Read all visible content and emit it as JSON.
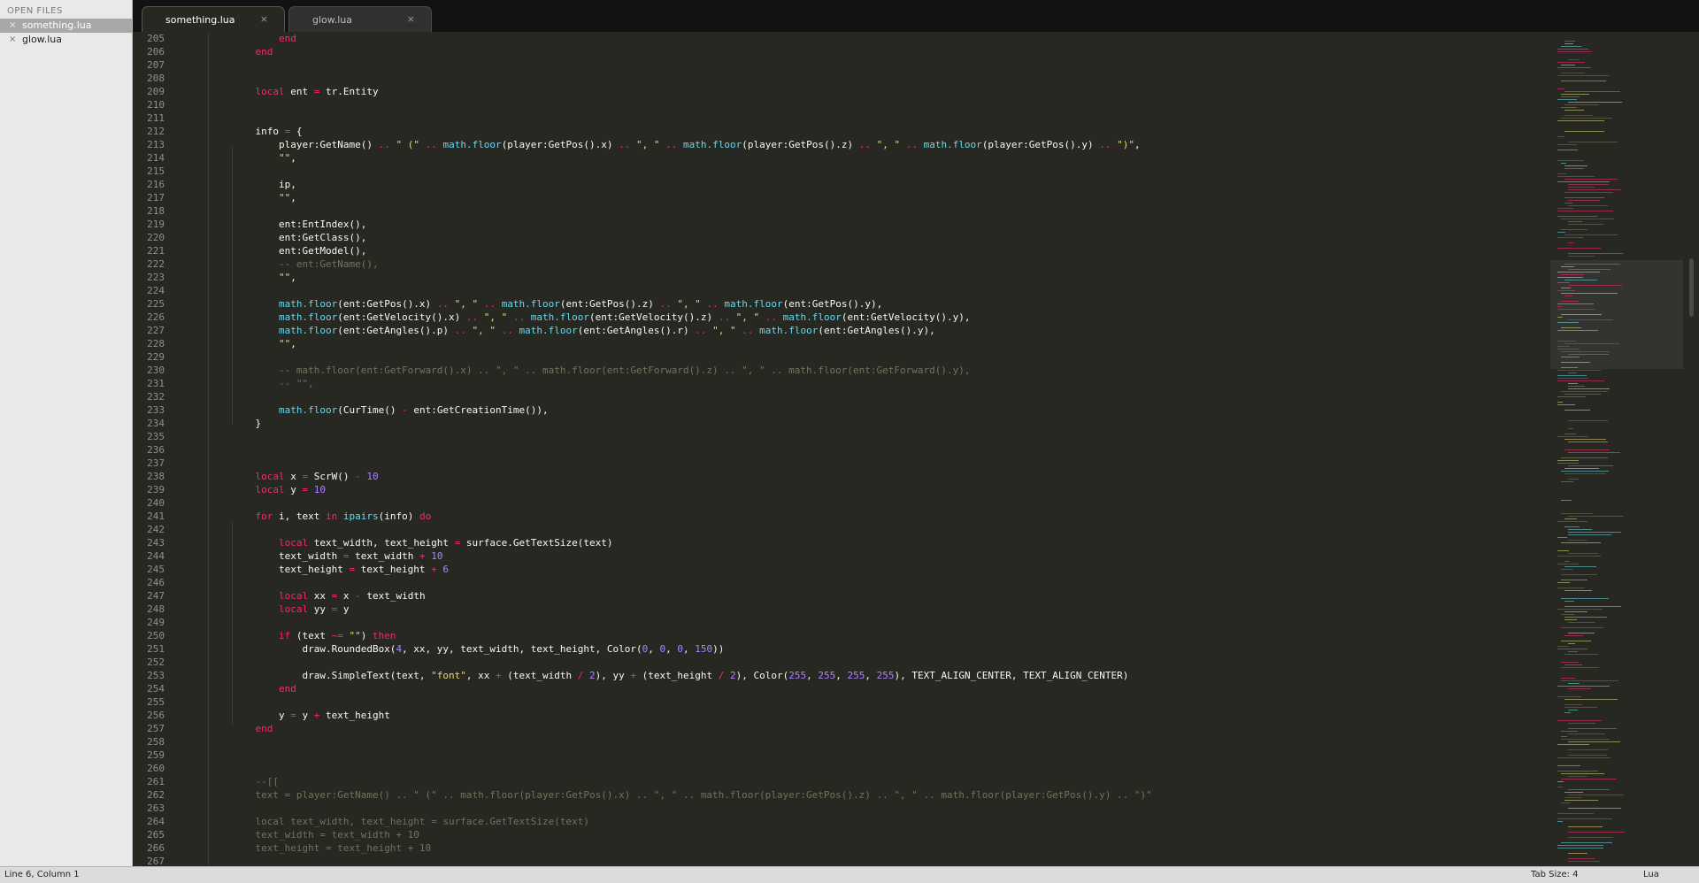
{
  "sidebar": {
    "header": "OPEN FILES",
    "files": [
      {
        "name": "something.lua",
        "active": true
      },
      {
        "name": "glow.lua",
        "active": false
      }
    ]
  },
  "tabs": [
    {
      "label": "something.lua",
      "active": true
    },
    {
      "label": "glow.lua",
      "active": false
    }
  ],
  "close_glyph": "×",
  "editor": {
    "lines": [
      {
        "n": "205",
        "c": [
          [
            "",
            "        "
          ],
          [
            "kw",
            "end"
          ]
        ]
      },
      {
        "n": "206",
        "c": [
          [
            "",
            "    "
          ],
          [
            "kw",
            "end"
          ]
        ]
      },
      {
        "n": "207",
        "c": []
      },
      {
        "n": "208",
        "c": []
      },
      {
        "n": "209",
        "c": [
          [
            "",
            "    "
          ],
          [
            "kw",
            "local"
          ],
          [
            "",
            " ent "
          ],
          [
            "op",
            "="
          ],
          [
            "",
            " tr.Entity"
          ]
        ]
      },
      {
        "n": "210",
        "c": []
      },
      {
        "n": "211",
        "c": []
      },
      {
        "n": "212",
        "c": [
          [
            "",
            "    info "
          ],
          [
            "op",
            "="
          ],
          [
            "",
            " {"
          ]
        ]
      },
      {
        "n": "213",
        "c": [
          [
            "",
            "        player:GetName() "
          ],
          [
            "op",
            ".."
          ],
          [
            "st",
            " \" (\" "
          ],
          [
            "op",
            ".."
          ],
          [
            "",
            " "
          ],
          [
            "fn",
            "math.floor"
          ],
          [
            "",
            "(player:GetPos().x) "
          ],
          [
            "op",
            ".."
          ],
          [
            "st",
            " \", \" "
          ],
          [
            "op",
            ".."
          ],
          [
            "",
            " "
          ],
          [
            "fn",
            "math.floor"
          ],
          [
            "",
            "(player:GetPos().z) "
          ],
          [
            "op",
            ".."
          ],
          [
            "st",
            " \", \" "
          ],
          [
            "op",
            ".."
          ],
          [
            "",
            " "
          ],
          [
            "fn",
            "math.floor"
          ],
          [
            "",
            "(player:GetPos().y) "
          ],
          [
            "op",
            ".."
          ],
          [
            "st",
            " \")\""
          ],
          [
            "",
            ","
          ]
        ]
      },
      {
        "n": "214",
        "c": [
          [
            "",
            "        "
          ],
          [
            "st",
            "\"\""
          ],
          [
            "",
            ","
          ]
        ]
      },
      {
        "n": "215",
        "c": []
      },
      {
        "n": "216",
        "c": [
          [
            "",
            "        ip,"
          ]
        ]
      },
      {
        "n": "217",
        "c": [
          [
            "",
            "        "
          ],
          [
            "st",
            "\"\""
          ],
          [
            "",
            ","
          ]
        ]
      },
      {
        "n": "218",
        "c": []
      },
      {
        "n": "219",
        "c": [
          [
            "",
            "        ent:EntIndex(),"
          ]
        ]
      },
      {
        "n": "220",
        "c": [
          [
            "",
            "        ent:GetClass(),"
          ]
        ]
      },
      {
        "n": "221",
        "c": [
          [
            "",
            "        ent:GetModel(),"
          ]
        ]
      },
      {
        "n": "222",
        "c": [
          [
            "",
            "        "
          ],
          [
            "cm",
            "-- ent:GetName(),"
          ]
        ]
      },
      {
        "n": "223",
        "c": [
          [
            "",
            "        "
          ],
          [
            "st",
            "\"\""
          ],
          [
            "",
            ","
          ]
        ]
      },
      {
        "n": "224",
        "c": []
      },
      {
        "n": "225",
        "c": [
          [
            "",
            "        "
          ],
          [
            "fn",
            "math.floor"
          ],
          [
            "",
            "(ent:GetPos().x) "
          ],
          [
            "op",
            ".."
          ],
          [
            "st",
            " \", \" "
          ],
          [
            "op",
            ".."
          ],
          [
            "",
            " "
          ],
          [
            "fn",
            "math.floor"
          ],
          [
            "",
            "(ent:GetPos().z) "
          ],
          [
            "op",
            ".."
          ],
          [
            "st",
            " \", \" "
          ],
          [
            "op",
            ".."
          ],
          [
            "",
            " "
          ],
          [
            "fn",
            "math.floor"
          ],
          [
            "",
            "(ent:GetPos().y),"
          ]
        ]
      },
      {
        "n": "226",
        "c": [
          [
            "",
            "        "
          ],
          [
            "fn",
            "math.floor"
          ],
          [
            "",
            "(ent:GetVelocity().x) "
          ],
          [
            "op",
            ".."
          ],
          [
            "st",
            " \", \" "
          ],
          [
            "op",
            ".."
          ],
          [
            "",
            " "
          ],
          [
            "fn",
            "math.floor"
          ],
          [
            "",
            "(ent:GetVelocity().z) "
          ],
          [
            "op",
            ".."
          ],
          [
            "st",
            " \", \" "
          ],
          [
            "op",
            ".."
          ],
          [
            "",
            " "
          ],
          [
            "fn",
            "math.floor"
          ],
          [
            "",
            "(ent:GetVelocity().y),"
          ]
        ]
      },
      {
        "n": "227",
        "c": [
          [
            "",
            "        "
          ],
          [
            "fn",
            "math.floor"
          ],
          [
            "",
            "(ent:GetAngles().p) "
          ],
          [
            "op",
            ".."
          ],
          [
            "st",
            " \", \" "
          ],
          [
            "op",
            ".."
          ],
          [
            "",
            " "
          ],
          [
            "fn",
            "math.floor"
          ],
          [
            "",
            "(ent:GetAngles().r) "
          ],
          [
            "op",
            ".."
          ],
          [
            "st",
            " \", \" "
          ],
          [
            "op",
            ".."
          ],
          [
            "",
            " "
          ],
          [
            "fn",
            "math.floor"
          ],
          [
            "",
            "(ent:GetAngles().y),"
          ]
        ]
      },
      {
        "n": "228",
        "c": [
          [
            "",
            "        "
          ],
          [
            "st",
            "\"\""
          ],
          [
            "",
            ","
          ]
        ]
      },
      {
        "n": "229",
        "c": []
      },
      {
        "n": "230",
        "c": [
          [
            "",
            "        "
          ],
          [
            "cm",
            "-- math.floor(ent:GetForward().x) .. \", \" .. math.floor(ent:GetForward().z) .. \", \" .. math.floor(ent:GetForward().y),"
          ]
        ]
      },
      {
        "n": "231",
        "c": [
          [
            "",
            "        "
          ],
          [
            "cm",
            "-- \"\","
          ]
        ]
      },
      {
        "n": "232",
        "c": []
      },
      {
        "n": "233",
        "c": [
          [
            "",
            "        "
          ],
          [
            "fn",
            "math.floor"
          ],
          [
            "",
            "(CurTime() "
          ],
          [
            "op",
            "-"
          ],
          [
            "",
            " ent:GetCreationTime()),"
          ]
        ]
      },
      {
        "n": "234",
        "c": [
          [
            "",
            "    }"
          ]
        ]
      },
      {
        "n": "235",
        "c": []
      },
      {
        "n": "236",
        "c": []
      },
      {
        "n": "237",
        "c": []
      },
      {
        "n": "238",
        "c": [
          [
            "",
            "    "
          ],
          [
            "kw",
            "local"
          ],
          [
            "",
            " x "
          ],
          [
            "op",
            "="
          ],
          [
            "",
            " ScrW() "
          ],
          [
            "op",
            "-"
          ],
          [
            "",
            " "
          ],
          [
            "nm",
            "10"
          ]
        ]
      },
      {
        "n": "239",
        "c": [
          [
            "",
            "    "
          ],
          [
            "kw",
            "local"
          ],
          [
            "",
            " y "
          ],
          [
            "op",
            "="
          ],
          [
            "",
            " "
          ],
          [
            "nm",
            "10"
          ]
        ]
      },
      {
        "n": "240",
        "c": []
      },
      {
        "n": "241",
        "c": [
          [
            "",
            "    "
          ],
          [
            "kw",
            "for"
          ],
          [
            "",
            " i, text "
          ],
          [
            "kw",
            "in"
          ],
          [
            "",
            " "
          ],
          [
            "fn",
            "ipairs"
          ],
          [
            "",
            "(info) "
          ],
          [
            "kw",
            "do"
          ]
        ]
      },
      {
        "n": "242",
        "c": []
      },
      {
        "n": "243",
        "c": [
          [
            "",
            "        "
          ],
          [
            "kw",
            "local"
          ],
          [
            "",
            " text_width, text_height "
          ],
          [
            "op",
            "="
          ],
          [
            "",
            " surface.GetTextSize(text)"
          ]
        ]
      },
      {
        "n": "244",
        "c": [
          [
            "",
            "        text_width "
          ],
          [
            "op",
            "="
          ],
          [
            "",
            " text_width "
          ],
          [
            "op",
            "+"
          ],
          [
            "",
            " "
          ],
          [
            "nm",
            "10"
          ]
        ]
      },
      {
        "n": "245",
        "c": [
          [
            "",
            "        text_height "
          ],
          [
            "op",
            "="
          ],
          [
            "",
            " text_height "
          ],
          [
            "op",
            "+"
          ],
          [
            "",
            " "
          ],
          [
            "nm",
            "6"
          ]
        ]
      },
      {
        "n": "246",
        "c": []
      },
      {
        "n": "247",
        "c": [
          [
            "",
            "        "
          ],
          [
            "kw",
            "local"
          ],
          [
            "",
            " xx "
          ],
          [
            "op",
            "="
          ],
          [
            "",
            " x "
          ],
          [
            "op",
            "-"
          ],
          [
            "",
            " text_width"
          ]
        ]
      },
      {
        "n": "248",
        "c": [
          [
            "",
            "        "
          ],
          [
            "kw",
            "local"
          ],
          [
            "",
            " yy "
          ],
          [
            "op",
            "="
          ],
          [
            "",
            " y"
          ]
        ]
      },
      {
        "n": "249",
        "c": []
      },
      {
        "n": "250",
        "c": [
          [
            "",
            "        "
          ],
          [
            "kw",
            "if"
          ],
          [
            "",
            " (text "
          ],
          [
            "op",
            "~="
          ],
          [
            "",
            " "
          ],
          [
            "st",
            "\"\""
          ],
          [
            "",
            ") "
          ],
          [
            "kw",
            "then"
          ]
        ]
      },
      {
        "n": "251",
        "c": [
          [
            "",
            "            draw.RoundedBox("
          ],
          [
            "nm",
            "4"
          ],
          [
            "",
            ", xx, yy, text_width, text_height, Color("
          ],
          [
            "nm",
            "0"
          ],
          [
            "",
            ", "
          ],
          [
            "nm",
            "0"
          ],
          [
            "",
            ", "
          ],
          [
            "nm",
            "0"
          ],
          [
            "",
            ", "
          ],
          [
            "nm",
            "150"
          ],
          [
            "",
            "))"
          ]
        ]
      },
      {
        "n": "252",
        "c": []
      },
      {
        "n": "253",
        "c": [
          [
            "",
            "            draw.SimpleText(text, "
          ],
          [
            "st",
            "\"font\""
          ],
          [
            "",
            ", xx "
          ],
          [
            "op",
            "+"
          ],
          [
            "",
            " (text_width "
          ],
          [
            "op",
            "/"
          ],
          [
            "",
            " "
          ],
          [
            "nm",
            "2"
          ],
          [
            "",
            "), yy "
          ],
          [
            "op",
            "+"
          ],
          [
            "",
            " (text_height "
          ],
          [
            "op",
            "/"
          ],
          [
            "",
            " "
          ],
          [
            "nm",
            "2"
          ],
          [
            "",
            "), Color("
          ],
          [
            "nm",
            "255"
          ],
          [
            "",
            ", "
          ],
          [
            "nm",
            "255"
          ],
          [
            "",
            ", "
          ],
          [
            "nm",
            "255"
          ],
          [
            "",
            ", "
          ],
          [
            "nm",
            "255"
          ],
          [
            "",
            "), TEXT_ALIGN_CENTER, TEXT_ALIGN_CENTER)"
          ]
        ]
      },
      {
        "n": "254",
        "c": [
          [
            "",
            "        "
          ],
          [
            "kw",
            "end"
          ]
        ]
      },
      {
        "n": "255",
        "c": []
      },
      {
        "n": "256",
        "c": [
          [
            "",
            "        y "
          ],
          [
            "op",
            "="
          ],
          [
            "",
            " y "
          ],
          [
            "op",
            "+"
          ],
          [
            "",
            " text_height"
          ]
        ]
      },
      {
        "n": "257",
        "c": [
          [
            "",
            "    "
          ],
          [
            "kw",
            "end"
          ]
        ]
      },
      {
        "n": "258",
        "c": []
      },
      {
        "n": "259",
        "c": []
      },
      {
        "n": "260",
        "c": []
      },
      {
        "n": "261",
        "c": [
          [
            "",
            "    "
          ],
          [
            "cm",
            "--[["
          ]
        ]
      },
      {
        "n": "262",
        "c": [
          [
            "",
            "    "
          ],
          [
            "cm",
            "text = player:GetName() .. \" (\" .. math.floor(player:GetPos().x) .. \", \" .. math.floor(player:GetPos().z) .. \", \" .. math.floor(player:GetPos().y) .. \")\""
          ]
        ]
      },
      {
        "n": "263",
        "c": []
      },
      {
        "n": "264",
        "c": [
          [
            "",
            "    "
          ],
          [
            "cm",
            "local text_width, text_height = surface.GetTextSize(text)"
          ]
        ]
      },
      {
        "n": "265",
        "c": [
          [
            "",
            "    "
          ],
          [
            "cm",
            "text_width = text_width + 10"
          ]
        ]
      },
      {
        "n": "266",
        "c": [
          [
            "",
            "    "
          ],
          [
            "cm",
            "text_height = text_height + 10"
          ]
        ]
      },
      {
        "n": "267",
        "c": []
      }
    ]
  },
  "status": {
    "position": "Line 6, Column 1",
    "tab_size": "Tab Size: 4",
    "syntax": "Lua"
  },
  "colors": {
    "background": "#272822",
    "keyword": "#f92672",
    "function": "#66d9ef",
    "string": "#e6db74",
    "number": "#ae81ff",
    "comment": "#75715e"
  }
}
